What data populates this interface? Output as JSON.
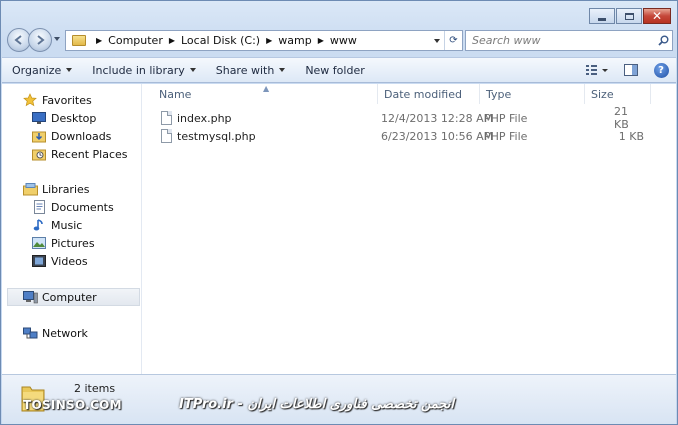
{
  "address": {
    "crumbs": [
      "Computer",
      "Local Disk (C:)",
      "wamp",
      "www"
    ]
  },
  "search": {
    "placeholder": "Search www"
  },
  "toolbar": {
    "organize": "Organize",
    "include_in_library": "Include in library",
    "share_with": "Share with",
    "new_folder": "New folder"
  },
  "nav": {
    "favorites": "Favorites",
    "desktop": "Desktop",
    "downloads": "Downloads",
    "recent_places": "Recent Places",
    "libraries": "Libraries",
    "documents": "Documents",
    "music": "Music",
    "pictures": "Pictures",
    "videos": "Videos",
    "computer": "Computer",
    "network": "Network"
  },
  "columns": {
    "name": "Name",
    "date_modified": "Date modified",
    "type": "Type",
    "size": "Size"
  },
  "files": [
    {
      "name": "index.php",
      "date": "12/4/2013 12:28 AM",
      "type": "PHP File",
      "size": "21 KB"
    },
    {
      "name": "testmysql.php",
      "date": "6/23/2013 10:56 AM",
      "type": "PHP File",
      "size": "1 KB"
    }
  ],
  "status": {
    "count": "2 items"
  },
  "watermark": {
    "left": "TOSINSO.COM",
    "right": "ITPro.ir - انجمن تخصصی فناوری اطلاعات ایران"
  },
  "colors": {
    "accent": "#1f4fa3",
    "window_frame": "#c3d6ef",
    "close_button": "#c5473a"
  }
}
